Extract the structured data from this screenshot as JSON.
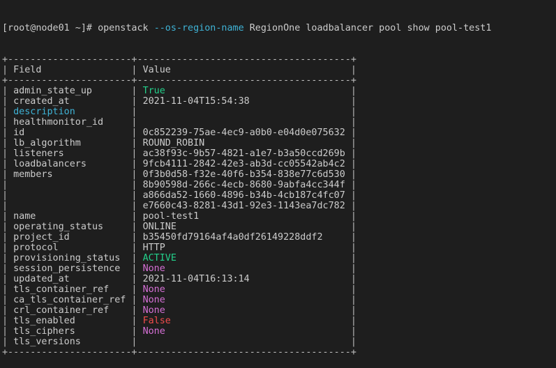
{
  "terminal": {
    "prompt": "[root@node01 ~]# ",
    "command": {
      "program": "openstack",
      "flag": "--os-region-name",
      "args": "RegionOne loadbalancer pool show pool-test1"
    }
  },
  "table": {
    "headers": {
      "field": "Field",
      "value": "Value"
    },
    "rows": [
      {
        "field": "admin_state_up",
        "values": [
          "True"
        ],
        "color": "green"
      },
      {
        "field": "created_at",
        "values": [
          "2021-11-04T15:54:38"
        ]
      },
      {
        "field": "description",
        "values": [
          ""
        ],
        "field_color": "cyan"
      },
      {
        "field": "healthmonitor_id",
        "values": [
          ""
        ]
      },
      {
        "field": "id",
        "values": [
          "0c852239-75ae-4ec9-a0b0-e04d0e075632"
        ]
      },
      {
        "field": "lb_algorithm",
        "values": [
          "ROUND_ROBIN"
        ]
      },
      {
        "field": "listeners",
        "values": [
          "ac38f93c-9b57-4821-a1e7-b3a50ccd269b"
        ]
      },
      {
        "field": "loadbalancers",
        "values": [
          "9fcb4111-2842-42e3-ab3d-cc05542ab4c2"
        ]
      },
      {
        "field": "members",
        "values": [
          "0f3b0d58-f32e-40f6-b354-838e77c6d530",
          "8b90598d-266c-4ecb-8680-9abfa4cc344f",
          "a866da52-1660-4896-b34b-4cb187c4fc07",
          "e7660c43-8281-43d1-92e3-1143ea7dc782"
        ]
      },
      {
        "field": "name",
        "values": [
          "pool-test1"
        ]
      },
      {
        "field": "operating_status",
        "values": [
          "ONLINE"
        ]
      },
      {
        "field": "project_id",
        "values": [
          "b35450fd79164af4a0df26149228ddf2"
        ]
      },
      {
        "field": "protocol",
        "values": [
          "HTTP"
        ]
      },
      {
        "field": "provisioning_status",
        "values": [
          "ACTIVE"
        ],
        "color": "green"
      },
      {
        "field": "session_persistence",
        "values": [
          "None"
        ],
        "color": "magenta"
      },
      {
        "field": "updated_at",
        "values": [
          "2021-11-04T16:13:14"
        ]
      },
      {
        "field": "tls_container_ref",
        "values": [
          "None"
        ],
        "color": "magenta"
      },
      {
        "field": "ca_tls_container_ref",
        "values": [
          "None"
        ],
        "color": "magenta"
      },
      {
        "field": "crl_container_ref",
        "values": [
          "None"
        ],
        "color": "magenta"
      },
      {
        "field": "tls_enabled",
        "values": [
          "False"
        ],
        "color": "red"
      },
      {
        "field": "tls_ciphers",
        "values": [
          "None"
        ],
        "color": "magenta"
      },
      {
        "field": "tls_versions",
        "values": [
          ""
        ]
      }
    ]
  },
  "colors": {
    "green": "#23d18b",
    "cyan": "#3fb3d6",
    "magenta": "#d670d6",
    "red": "#f14c4c",
    "background": "#1e1e1e",
    "text": "#cccccc"
  }
}
